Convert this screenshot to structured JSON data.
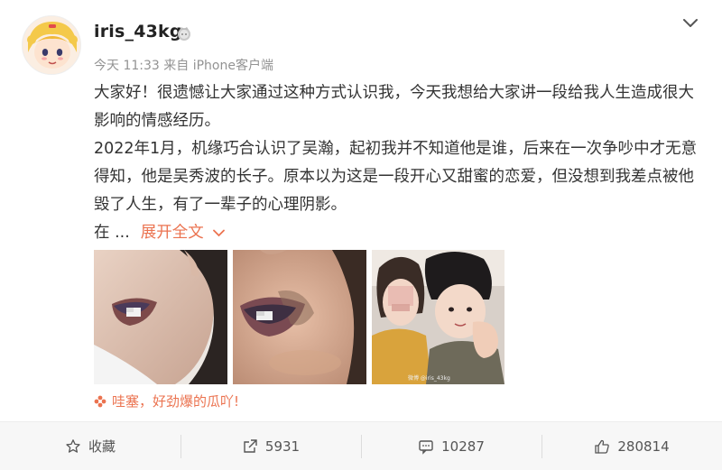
{
  "header": {
    "username": "iris_43kg",
    "meta": "今天 11:33 来自 iPhone客户端",
    "avatar_icon": "cartoon-avatar",
    "badge_icon": "vip-badge-icon",
    "menu_icon": "chevron-down-icon"
  },
  "content": {
    "p1": "大家好！很遗憾让大家通过这种方式认识我，今天我想给大家讲一段给我人生造成很大影响的情感经历。",
    "p2": "2022年1月，机缘巧合认识了吴瀚，起初我并不知道他是谁，后来在一次争吵中才无意得知，他是吴秀波的长子。原本以为这是一段开心又甜蜜的恋爱，但没想到我差点被他毁了人生，有了一辈子的心理阴影。",
    "truncated_prefix": "在 ...",
    "expand_label": "展开全文",
    "accent_color": "#eb7350"
  },
  "media": {
    "photo3_watermark": "微博 @iris_43kg"
  },
  "tagline": {
    "text": "哇塞，好劲爆的瓜吖!",
    "icon": "flower-icon"
  },
  "actions": {
    "favorite_label": "收藏",
    "repost_count": "5931",
    "comment_count": "10287",
    "like_count": "280814"
  }
}
